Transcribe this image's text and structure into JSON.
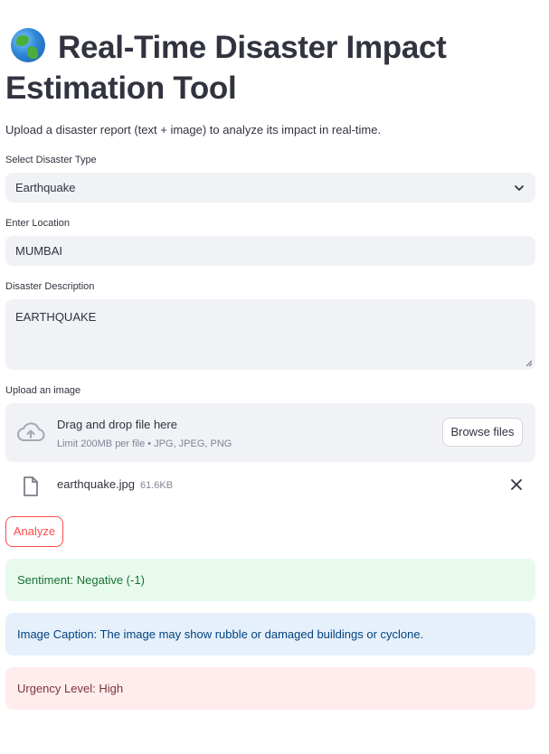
{
  "header": {
    "title": "Real-Time Disaster Impact Estimation Tool",
    "icon": "globe-icon",
    "subtitle": "Upload a disaster report (text + image) to analyze its impact in real-time."
  },
  "form": {
    "disaster_type": {
      "label": "Select Disaster Type",
      "value": "Earthquake"
    },
    "location": {
      "label": "Enter Location",
      "value": "MUMBAI"
    },
    "description": {
      "label": "Disaster Description",
      "value": "EARTHQUAKE"
    },
    "upload": {
      "label": "Upload an image",
      "drop_text": "Drag and drop file here",
      "limit_text": "Limit 200MB per file • JPG, JPEG, PNG",
      "browse_label": "Browse files"
    },
    "uploaded_file": {
      "name": "earthquake.jpg",
      "size": "61.6KB"
    },
    "analyze_label": "Analyze"
  },
  "results": {
    "sentiment": "Sentiment: Negative (-1)",
    "caption": "Image Caption: The image may show rubble or damaged buildings or cyclone.",
    "urgency": "Urgency Level: High"
  },
  "colors": {
    "accent": "#ff4b4b",
    "input_bg": "#f0f2f6",
    "success_bg": "#e8f9ee",
    "success_text": "#177233",
    "info_bg": "#e6f0fb",
    "info_text": "#004280",
    "error_bg": "#ffecec",
    "error_text": "#7d353b"
  }
}
